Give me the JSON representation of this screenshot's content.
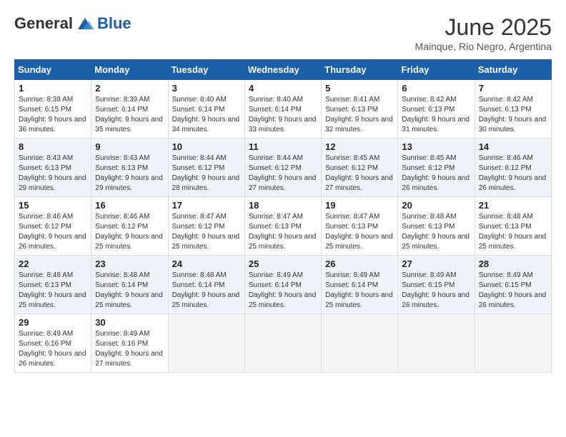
{
  "header": {
    "logo_general": "General",
    "logo_blue": "Blue",
    "month_title": "June 2025",
    "subtitle": "Mainque, Rio Negro, Argentina"
  },
  "weekdays": [
    "Sunday",
    "Monday",
    "Tuesday",
    "Wednesday",
    "Thursday",
    "Friday",
    "Saturday"
  ],
  "weeks": [
    [
      {
        "day": "1",
        "info": "Sunrise: 8:38 AM\nSunset: 6:15 PM\nDaylight: 9 hours and 36 minutes."
      },
      {
        "day": "2",
        "info": "Sunrise: 8:39 AM\nSunset: 6:14 PM\nDaylight: 9 hours and 35 minutes."
      },
      {
        "day": "3",
        "info": "Sunrise: 8:40 AM\nSunset: 6:14 PM\nDaylight: 9 hours and 34 minutes."
      },
      {
        "day": "4",
        "info": "Sunrise: 8:40 AM\nSunset: 6:14 PM\nDaylight: 9 hours and 33 minutes."
      },
      {
        "day": "5",
        "info": "Sunrise: 8:41 AM\nSunset: 6:13 PM\nDaylight: 9 hours and 32 minutes."
      },
      {
        "day": "6",
        "info": "Sunrise: 8:42 AM\nSunset: 6:13 PM\nDaylight: 9 hours and 31 minutes."
      },
      {
        "day": "7",
        "info": "Sunrise: 8:42 AM\nSunset: 6:13 PM\nDaylight: 9 hours and 30 minutes."
      }
    ],
    [
      {
        "day": "8",
        "info": "Sunrise: 8:43 AM\nSunset: 6:13 PM\nDaylight: 9 hours and 29 minutes."
      },
      {
        "day": "9",
        "info": "Sunrise: 8:43 AM\nSunset: 6:13 PM\nDaylight: 9 hours and 29 minutes."
      },
      {
        "day": "10",
        "info": "Sunrise: 8:44 AM\nSunset: 6:12 PM\nDaylight: 9 hours and 28 minutes."
      },
      {
        "day": "11",
        "info": "Sunrise: 8:44 AM\nSunset: 6:12 PM\nDaylight: 9 hours and 27 minutes."
      },
      {
        "day": "12",
        "info": "Sunrise: 8:45 AM\nSunset: 6:12 PM\nDaylight: 9 hours and 27 minutes."
      },
      {
        "day": "13",
        "info": "Sunrise: 8:45 AM\nSunset: 6:12 PM\nDaylight: 9 hours and 26 minutes."
      },
      {
        "day": "14",
        "info": "Sunrise: 8:46 AM\nSunset: 6:12 PM\nDaylight: 9 hours and 26 minutes."
      }
    ],
    [
      {
        "day": "15",
        "info": "Sunrise: 8:46 AM\nSunset: 6:12 PM\nDaylight: 9 hours and 26 minutes."
      },
      {
        "day": "16",
        "info": "Sunrise: 8:46 AM\nSunset: 6:12 PM\nDaylight: 9 hours and 25 minutes."
      },
      {
        "day": "17",
        "info": "Sunrise: 8:47 AM\nSunset: 6:12 PM\nDaylight: 9 hours and 25 minutes."
      },
      {
        "day": "18",
        "info": "Sunrise: 8:47 AM\nSunset: 6:13 PM\nDaylight: 9 hours and 25 minutes."
      },
      {
        "day": "19",
        "info": "Sunrise: 8:47 AM\nSunset: 6:13 PM\nDaylight: 9 hours and 25 minutes."
      },
      {
        "day": "20",
        "info": "Sunrise: 8:48 AM\nSunset: 6:13 PM\nDaylight: 9 hours and 25 minutes."
      },
      {
        "day": "21",
        "info": "Sunrise: 8:48 AM\nSunset: 6:13 PM\nDaylight: 9 hours and 25 minutes."
      }
    ],
    [
      {
        "day": "22",
        "info": "Sunrise: 8:48 AM\nSunset: 6:13 PM\nDaylight: 9 hours and 25 minutes."
      },
      {
        "day": "23",
        "info": "Sunrise: 8:48 AM\nSunset: 6:14 PM\nDaylight: 9 hours and 25 minutes."
      },
      {
        "day": "24",
        "info": "Sunrise: 8:48 AM\nSunset: 6:14 PM\nDaylight: 9 hours and 25 minutes."
      },
      {
        "day": "25",
        "info": "Sunrise: 8:49 AM\nSunset: 6:14 PM\nDaylight: 9 hours and 25 minutes."
      },
      {
        "day": "26",
        "info": "Sunrise: 8:49 AM\nSunset: 6:14 PM\nDaylight: 9 hours and 25 minutes."
      },
      {
        "day": "27",
        "info": "Sunrise: 8:49 AM\nSunset: 6:15 PM\nDaylight: 9 hours and 26 minutes."
      },
      {
        "day": "28",
        "info": "Sunrise: 8:49 AM\nSunset: 6:15 PM\nDaylight: 9 hours and 26 minutes."
      }
    ],
    [
      {
        "day": "29",
        "info": "Sunrise: 8:49 AM\nSunset: 6:16 PM\nDaylight: 9 hours and 26 minutes."
      },
      {
        "day": "30",
        "info": "Sunrise: 8:49 AM\nSunset: 6:16 PM\nDaylight: 9 hours and 27 minutes."
      },
      {
        "day": "",
        "info": ""
      },
      {
        "day": "",
        "info": ""
      },
      {
        "day": "",
        "info": ""
      },
      {
        "day": "",
        "info": ""
      },
      {
        "day": "",
        "info": ""
      }
    ]
  ]
}
